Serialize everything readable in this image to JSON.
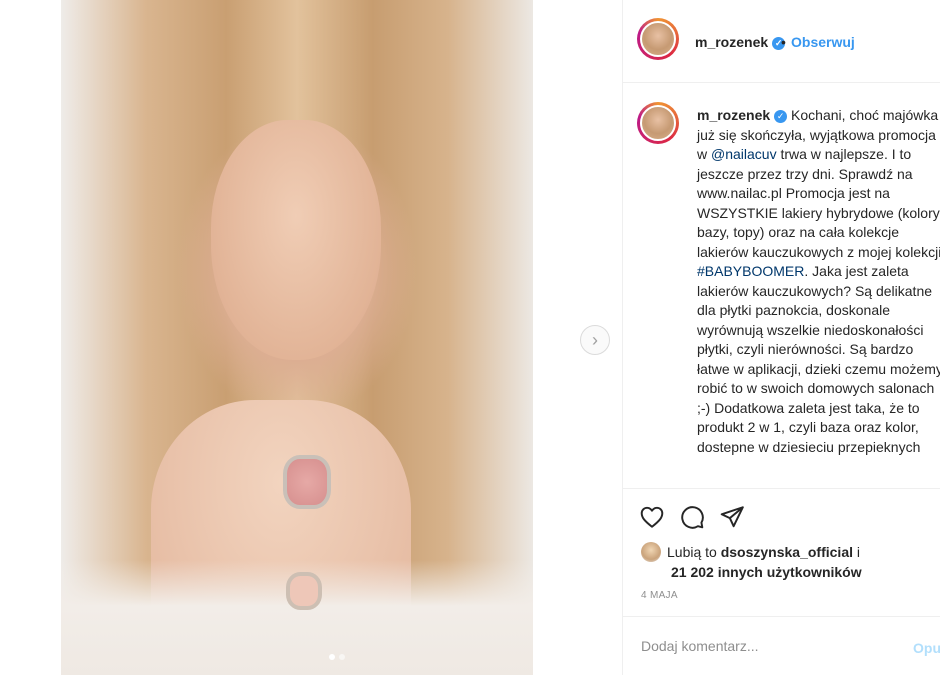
{
  "post": {
    "carousel": {
      "slide_count": 2,
      "active_slide": 1
    },
    "next_arrow_glyph": "›"
  },
  "header": {
    "username": "m_rozenek",
    "verified_glyph": "✓",
    "bullet": "•",
    "follow_label": "Obserwuj"
  },
  "caption": {
    "username": "m_rozenek",
    "text_1": " Kochani, choć majówka już się skończyła, wyjątkowa promocja w ",
    "mention": "@nailacuv",
    "text_2": " trwa w najlepsze. I to jeszcze przez trzy dni. Sprawdź na www.nailac.pl Promocja jest na WSZYSTKIE lakiery hybrydowe (kolory, bazy, topy) oraz na cała kolekcje lakierów kauczukowych z mojej kolekcji ",
    "hashtag": "#BABYBOOMER",
    "text_3": ". Jaka jest zaleta lakierów kauczukowych? Są delikatne dla płytki paznokcia, doskonale wyrównują wszelkie niedoskonałości płytki, czyli nierówności. Są bardzo łatwe w aplikacji, dzieki czemu możemy robić to w swoich domowych salonach ;-) Dodatkowa zaleta jest taka, że to produkt 2 w 1, czyli baza oraz kolor, dostepne w dziesieciu przepieknych"
  },
  "actions": {
    "like_icon": "heart-icon",
    "comment_icon": "comment-icon",
    "share_icon": "share-icon"
  },
  "likes": {
    "prefix": "Lubią to ",
    "liker": "dsoszynska_official",
    "connector": " i",
    "others": "21 202 innych użytkowników"
  },
  "date": "4 MAJA",
  "comment": {
    "placeholder": "Dodaj komentarz...",
    "publish_label": "Opublikuj"
  },
  "colors": {
    "accent_blue": "#3897f0",
    "link": "#00376b",
    "muted": "#8e8e8e",
    "publish_disabled": "#b2dffc"
  }
}
